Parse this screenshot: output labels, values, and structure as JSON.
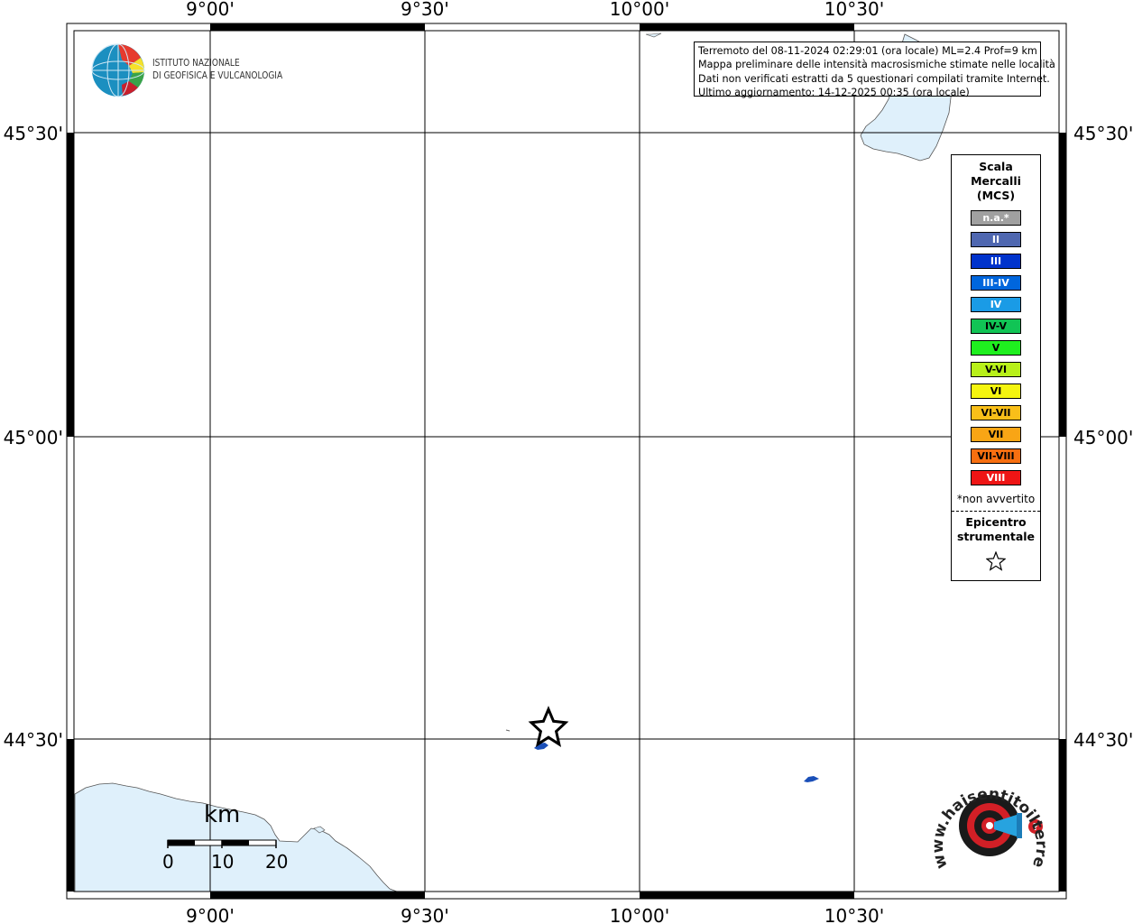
{
  "map": {
    "longitude_labels": [
      "9°00'",
      "9°30'",
      "10°00'",
      "10°30'"
    ],
    "latitude_labels": [
      "45°30'",
      "45°00'",
      "44°30'"
    ],
    "colors": {
      "sea": "#dff0fb",
      "coast": "#555555",
      "frame": "#000000",
      "grid": "#000000",
      "felt_point": "#1a4fb8"
    }
  },
  "info": {
    "line1": "Terremoto del 08-11-2024 02:29:01 (ora locale) ML=2.4 Prof=9 km",
    "line2": "Mappa preliminare delle intensità macrosismiche stimate nelle località",
    "line3": "Dati non verificati estratti da 5 questionari compilati tramite Internet.",
    "line4": "Ultimo aggiornamento: 14-12-2025 00:35 (ora locale)"
  },
  "logo": {
    "line1": "ISTITUTO NAZIONALE",
    "line2": "DI GEOFISICA E VULCANOLOGIA",
    "icon": "globe-icon"
  },
  "legend": {
    "title_line1": "Scala",
    "title_line2": "Mercalli",
    "title_line3": "(MCS)",
    "items": [
      {
        "label": "n.a.*",
        "color": "#a0a0a0",
        "text_color": "#ffffff"
      },
      {
        "label": "II",
        "color": "#4f67b0",
        "text_color": "#ffffff"
      },
      {
        "label": "III",
        "color": "#0033cc",
        "text_color": "#ffffff"
      },
      {
        "label": "III-IV",
        "color": "#0066dd",
        "text_color": "#ffffff"
      },
      {
        "label": "IV",
        "color": "#1a9be6",
        "text_color": "#ffffff"
      },
      {
        "label": "IV-V",
        "color": "#11c455",
        "text_color": "#000000"
      },
      {
        "label": "V",
        "color": "#1fef1f",
        "text_color": "#000000"
      },
      {
        "label": "V-VI",
        "color": "#b8f01a",
        "text_color": "#000000"
      },
      {
        "label": "VI",
        "color": "#f5f50f",
        "text_color": "#000000"
      },
      {
        "label": "VI-VII",
        "color": "#f9bf19",
        "text_color": "#000000"
      },
      {
        "label": "VII",
        "color": "#f9a515",
        "text_color": "#000000"
      },
      {
        "label": "VII-VIII",
        "color": "#f76f10",
        "text_color": "#000000"
      },
      {
        "label": "VIII",
        "color": "#ee1515",
        "text_color": "#ffffff"
      }
    ],
    "note": "*non avvertito",
    "epicenter_line1": "Epicentro",
    "epicenter_line2": "strumentale",
    "epicenter_icon": "star-icon"
  },
  "scale_bar": {
    "title": "km",
    "labels": [
      "0",
      "10",
      "20"
    ]
  },
  "brand": {
    "text": "www.haisentitoilterremoto.it",
    "icon": "target-megaphone-icon"
  }
}
